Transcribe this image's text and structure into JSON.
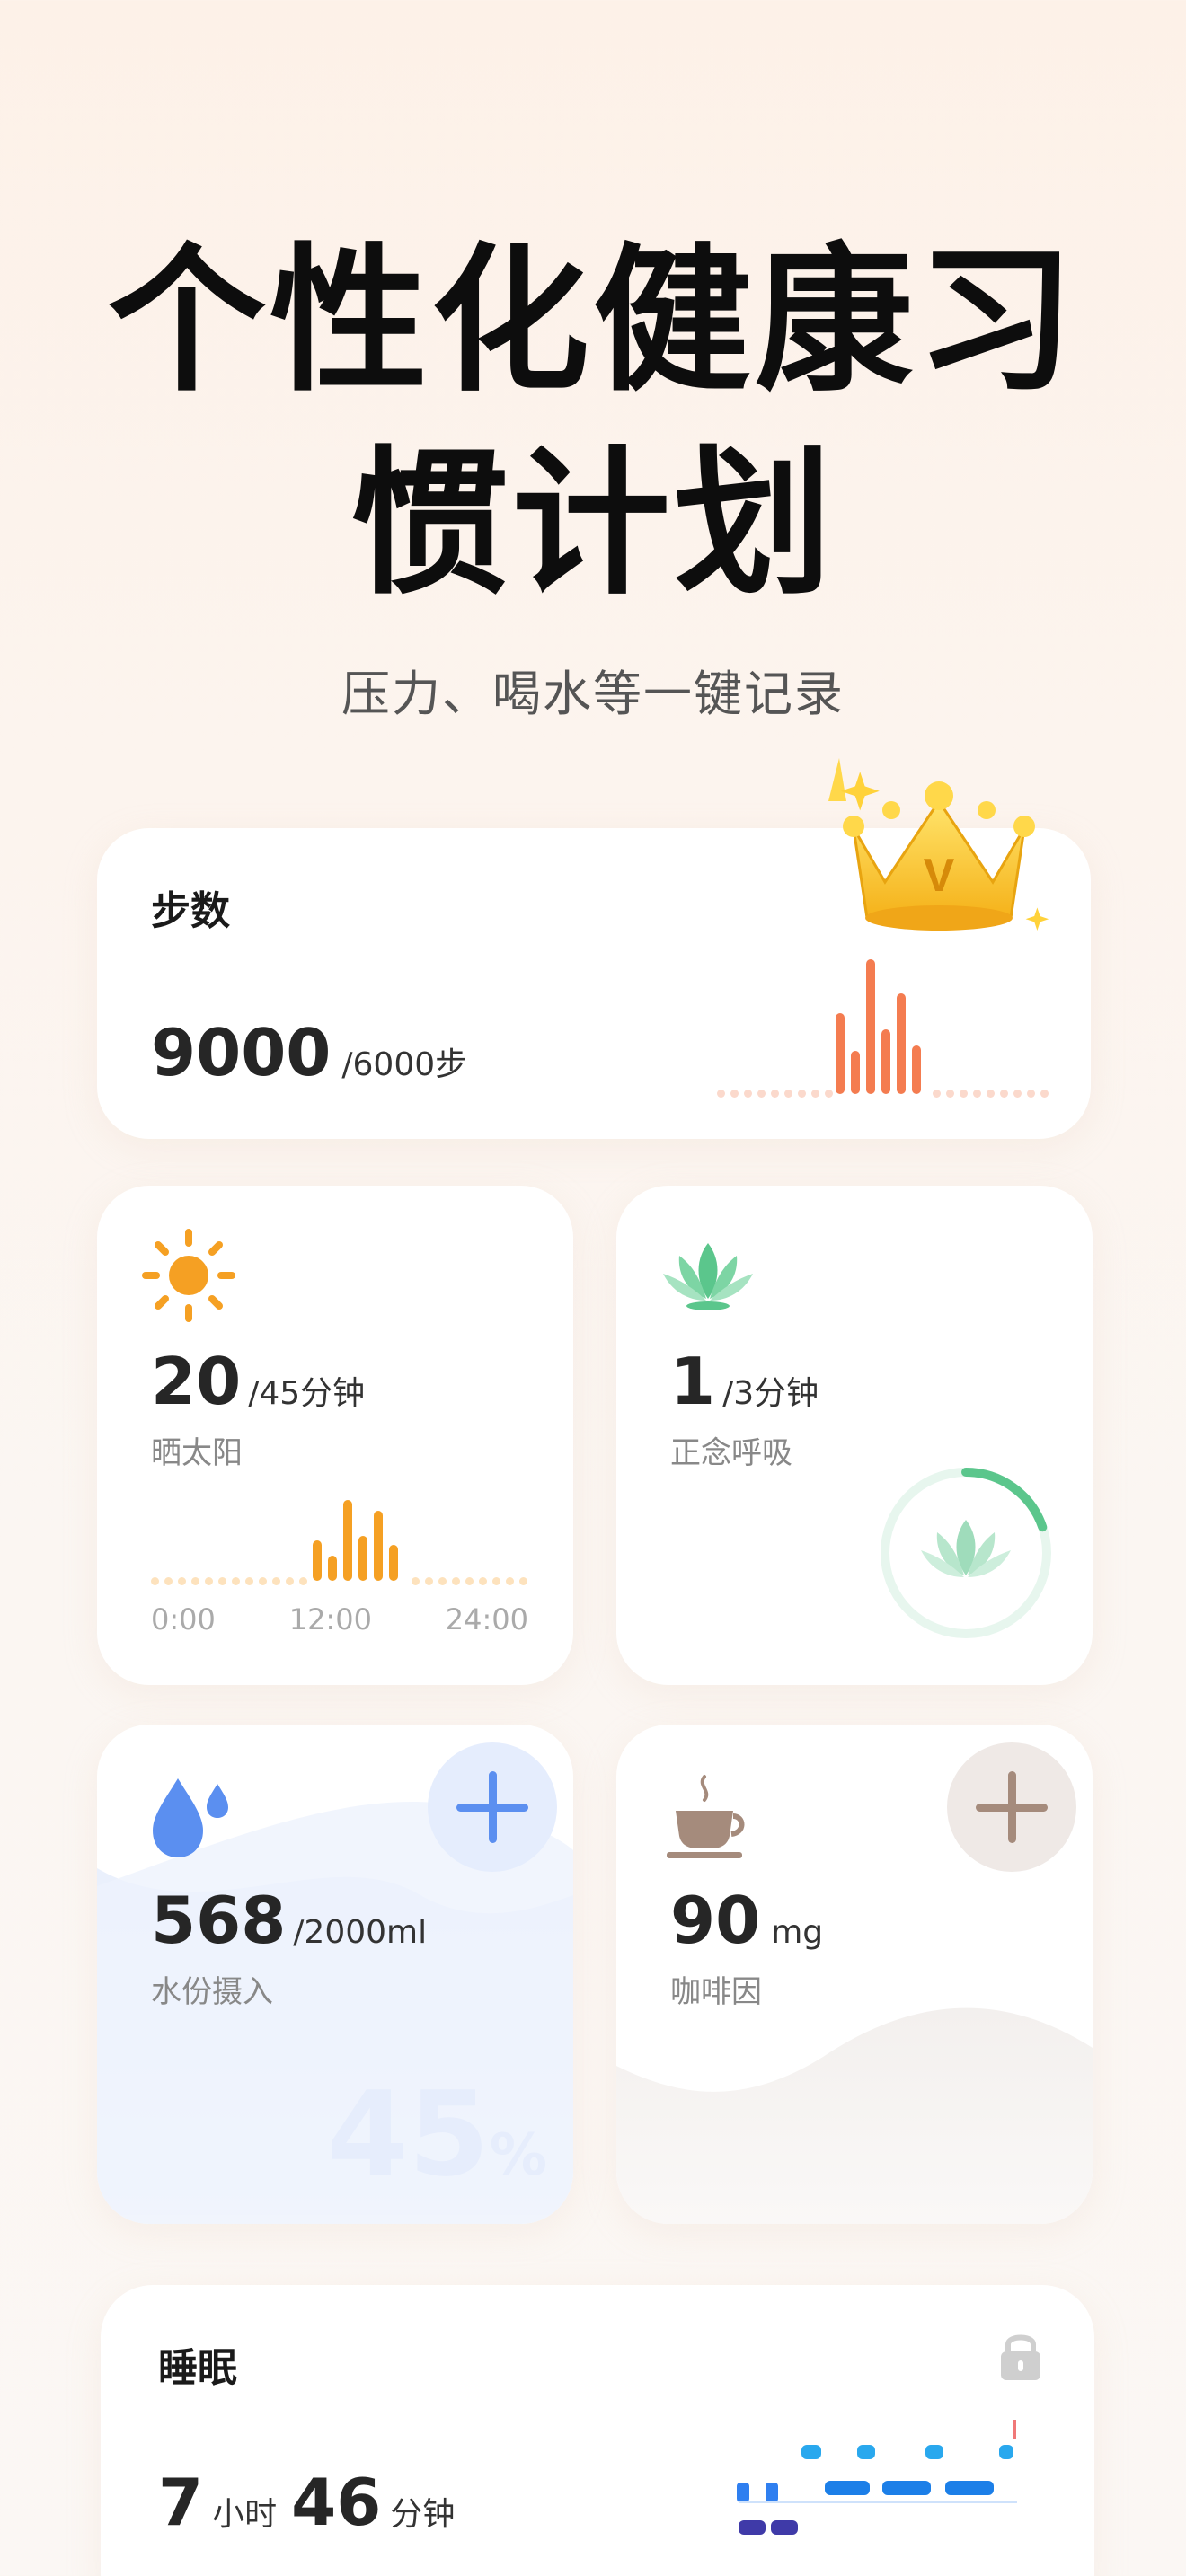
{
  "hero": {
    "title_line1": "个性化健康习",
    "title_line2": "惯计划",
    "subtitle": "压力、喝水等一键记录"
  },
  "steps": {
    "title": "步数",
    "value": "9000",
    "goal": "/6000步",
    "icon": "crown-icon",
    "crown_letter": "V",
    "accent": "#f47c50",
    "bars": [
      0.6,
      0.32,
      1.0,
      0.48,
      0.75,
      0.36
    ]
  },
  "sun": {
    "value": "20",
    "goal": "/45分钟",
    "label": "晒太阳",
    "accent": "#f5a023",
    "axis": [
      "0:00",
      "12:00",
      "24:00"
    ],
    "bars": [
      0.45,
      0.28,
      0.9,
      0.5,
      0.78,
      0.4
    ]
  },
  "mindful": {
    "value": "1",
    "goal": "/3分钟",
    "label": "正念呼吸",
    "accent": "#5bc68c",
    "progress": 0.33
  },
  "water": {
    "value": "568",
    "goal": "/2000ml",
    "label": "水份摄入",
    "percent": "45",
    "percent_sign": "%",
    "accent": "#5b8ff0"
  },
  "coffee": {
    "value": "90",
    "unit": "mg",
    "label": "咖啡因",
    "accent": "#a58b7c"
  },
  "sleep": {
    "title": "睡眠",
    "hours": "7",
    "hours_unit": "小时",
    "minutes": "46",
    "minutes_unit": "分钟"
  }
}
